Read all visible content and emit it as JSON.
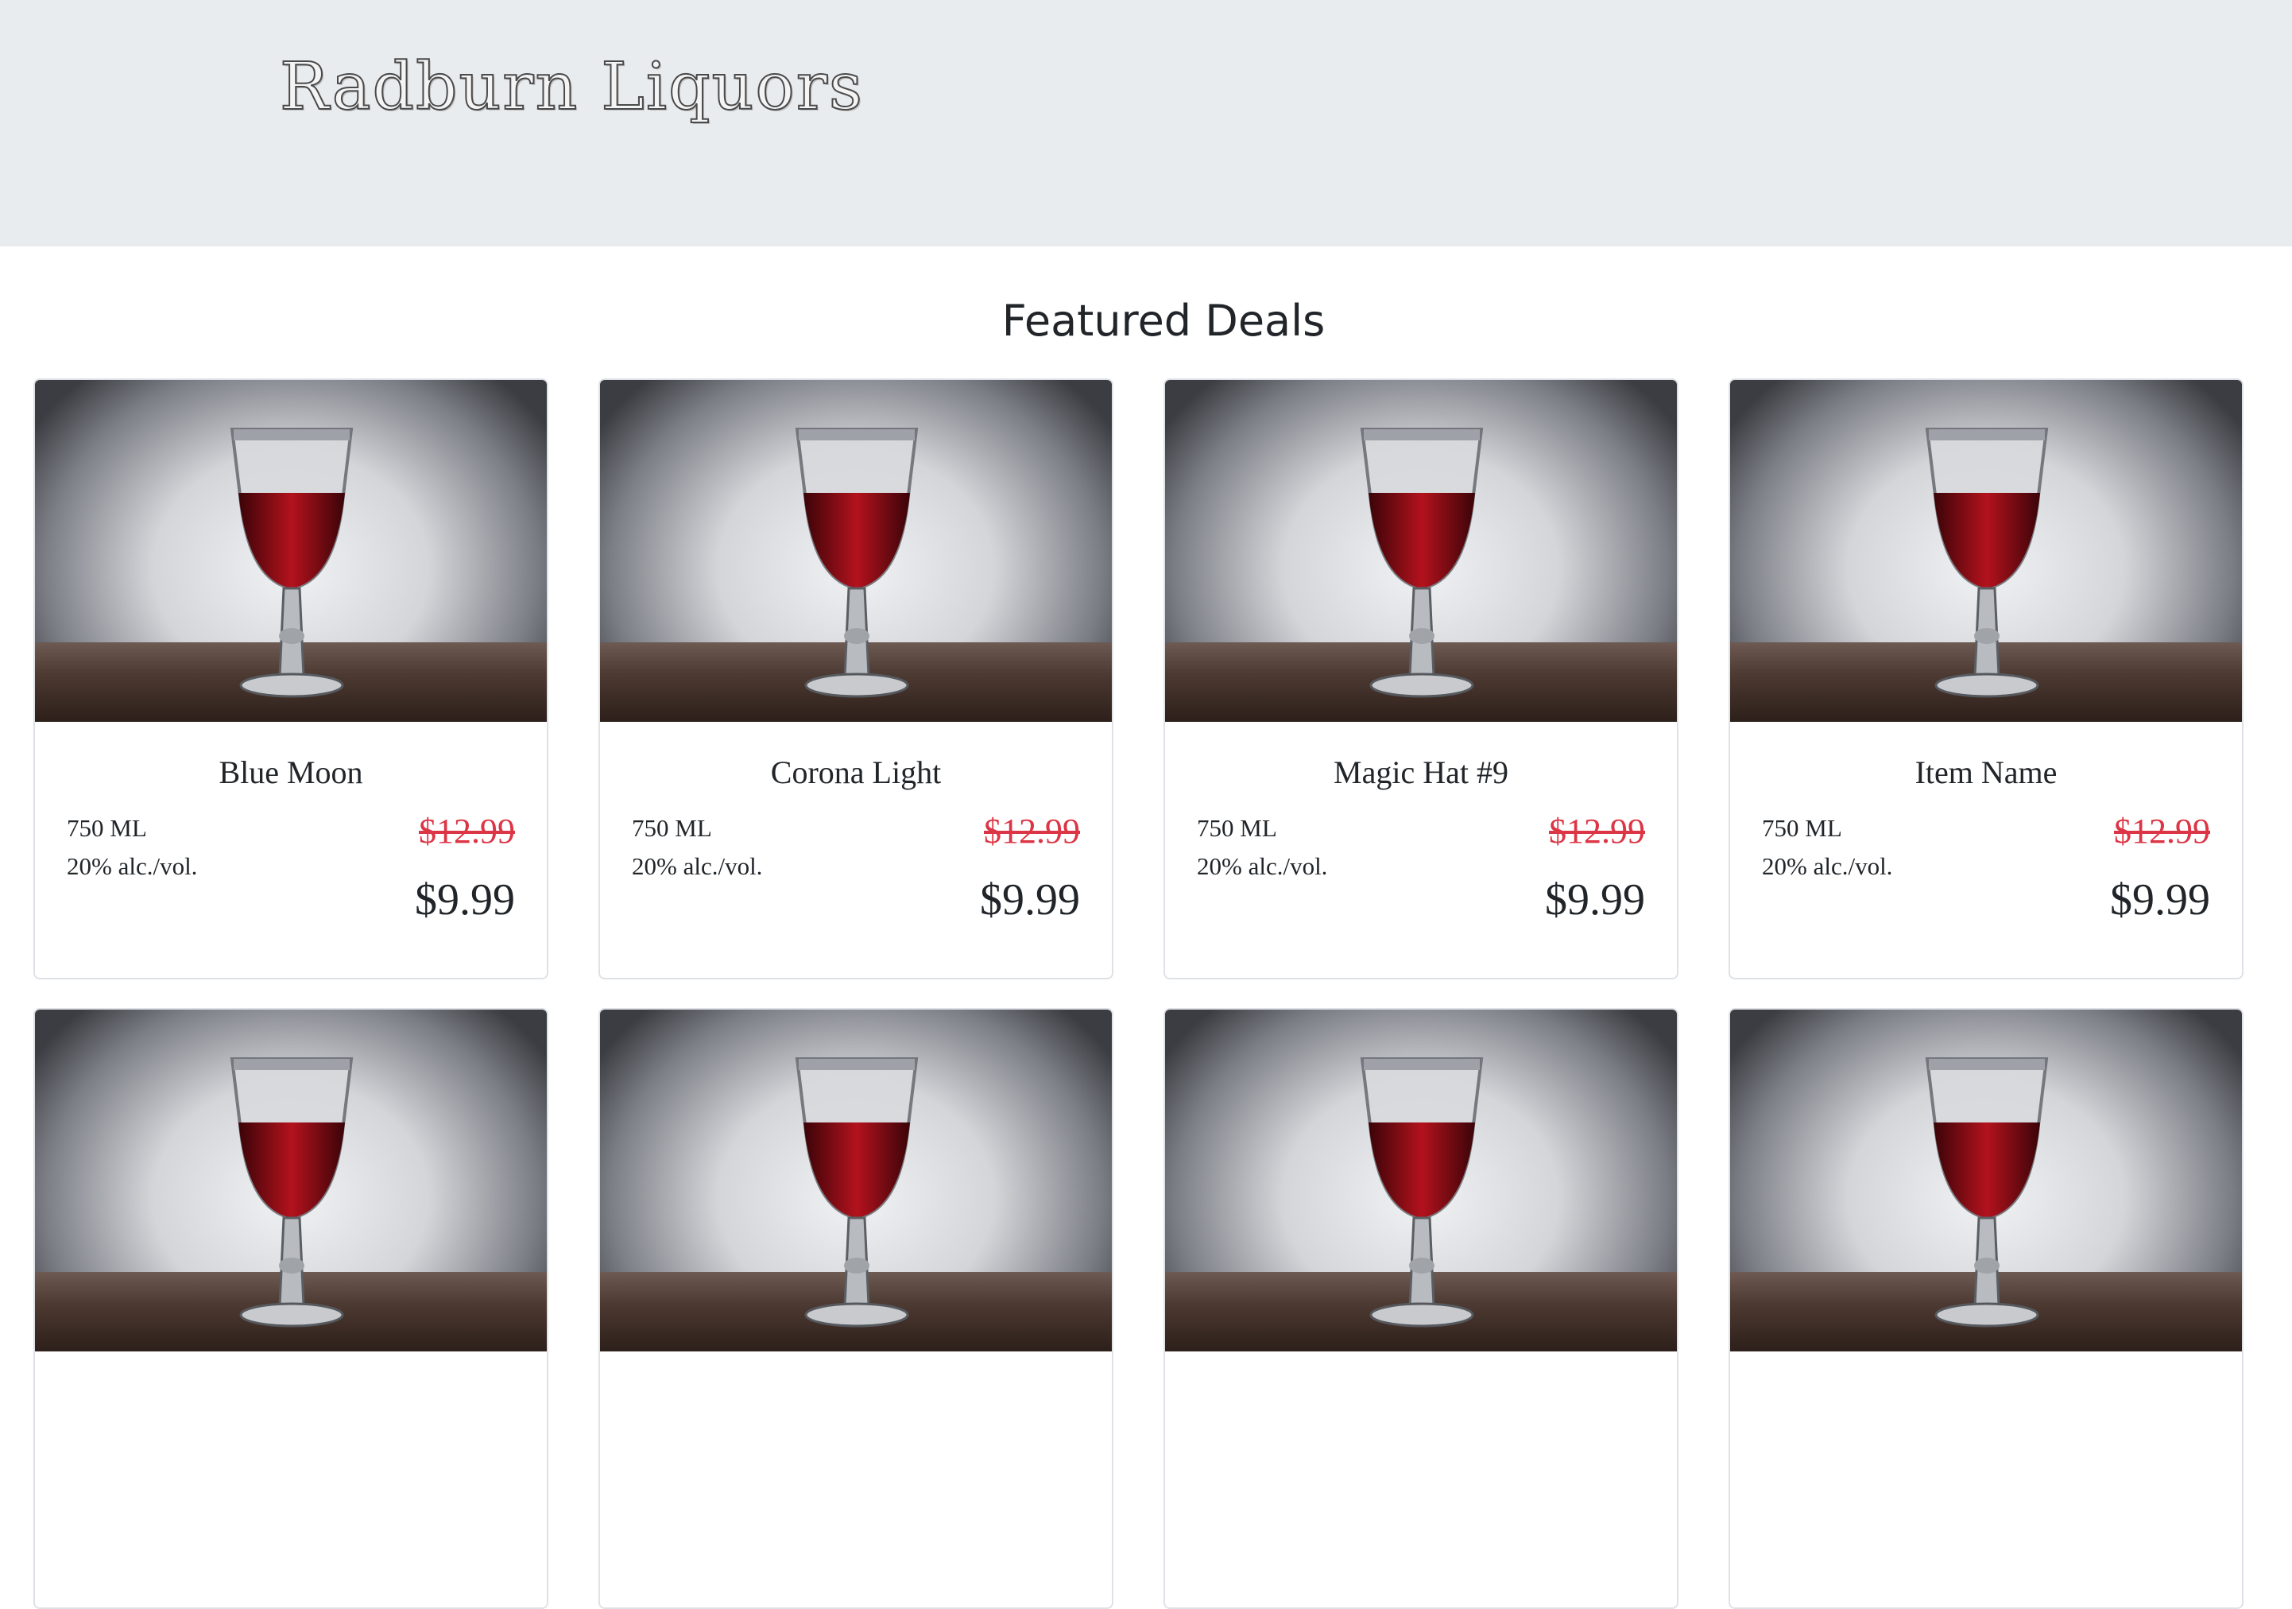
{
  "header": {
    "logo_text": "Radburn Liquors"
  },
  "main": {
    "section_title": "Featured Deals",
    "products": [
      {
        "name": "Blue Moon",
        "volume": "750 ML",
        "abv": "20% alc./vol.",
        "old_price": "$12.99",
        "price": "$9.99"
      },
      {
        "name": "Corona Light",
        "volume": "750 ML",
        "abv": "20% alc./vol.",
        "old_price": "$12.99",
        "price": "$9.99"
      },
      {
        "name": "Magic Hat #9",
        "volume": "750 ML",
        "abv": "20% alc./vol.",
        "old_price": "$12.99",
        "price": "$9.99"
      },
      {
        "name": "Item Name",
        "volume": "750 ML",
        "abv": "20% alc./vol.",
        "old_price": "$12.99",
        "price": "$9.99"
      }
    ]
  },
  "colors": {
    "header_bg": "#e9ecef",
    "old_price": "#dc3545",
    "text": "#212529",
    "wine": "#7a0a12"
  }
}
